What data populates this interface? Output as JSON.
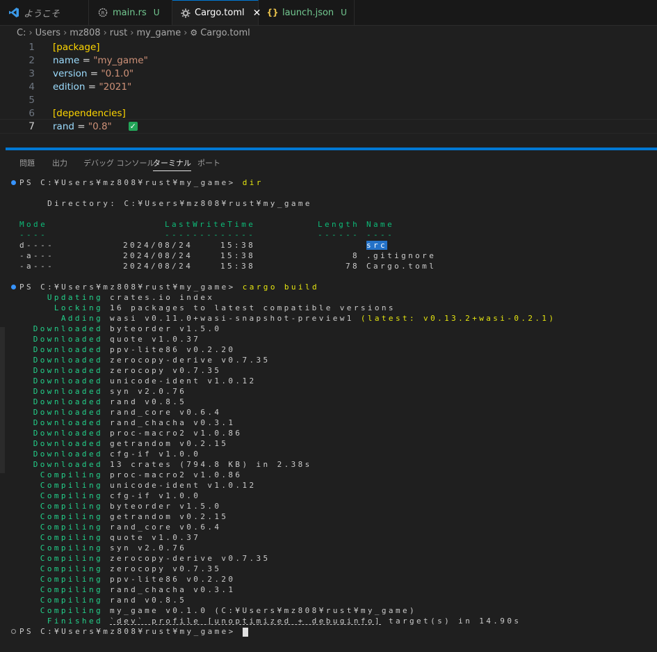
{
  "tabs": [
    {
      "label": "ようこそ",
      "icon": "vscode-icon",
      "modified": "",
      "active": false
    },
    {
      "label": "main.rs",
      "icon": "rust-icon",
      "modified": "U",
      "active": false
    },
    {
      "label": "Cargo.toml",
      "icon": "gear-icon",
      "modified": "",
      "active": true
    },
    {
      "label": "launch.json",
      "icon": "json-braces-icon",
      "modified": "U",
      "active": false
    }
  ],
  "breadcrumb": [
    "C:",
    "Users",
    "mz808",
    "rust",
    "my_game",
    "Cargo.toml"
  ],
  "editor": {
    "lines": [
      {
        "n": "1",
        "text": "[package]"
      },
      {
        "n": "2",
        "key": "name",
        "value": "\"my_game\""
      },
      {
        "n": "3",
        "key": "version",
        "value": "\"0.1.0\""
      },
      {
        "n": "4",
        "key": "edition",
        "value": "\"2021\""
      },
      {
        "n": "5",
        "text": ""
      },
      {
        "n": "6",
        "text": "[dependencies]"
      },
      {
        "n": "7",
        "key": "rand",
        "value": "\"0.8\""
      }
    ],
    "eq": " = ",
    "check_glyph": "✓"
  },
  "panel_tabs": [
    "問題",
    "出力",
    "デバッグ コンソール",
    "ターミナル",
    "ポート"
  ],
  "terminal": {
    "prompt": "PS C:¥Users¥mz808¥rust¥my_game>",
    "cmd1": "dir",
    "directory_line": "    Directory: C:¥Users¥mz808¥rust¥my_game",
    "headers": {
      "mode": "Mode",
      "time": "LastWriteTime",
      "length": "Length",
      "name": "Name"
    },
    "underlines": {
      "mode": "----",
      "time": "-------------",
      "length": "------",
      "name": "----"
    },
    "rows": [
      {
        "mode": "d----",
        "date": "2024/08/24",
        "time": "15:38",
        "length": "",
        "name": "src"
      },
      {
        "mode": "-a---",
        "date": "2024/08/24",
        "time": "15:38",
        "length": "8",
        "name": ".gitignore"
      },
      {
        "mode": "-a---",
        "date": "2024/08/24",
        "time": "15:38",
        "length": "78",
        "name": "Cargo.toml"
      }
    ],
    "cmd2": "cargo build",
    "cargo": [
      {
        "tag": "Updating",
        "text": "crates.io index"
      },
      {
        "tag": "Locking",
        "text": "16 packages to latest compatible versions"
      },
      {
        "tag": "Adding",
        "text": "wasi v0.11.0+wasi-snapshot-preview1 ",
        "extra": "(latest: v0.13.2+wasi-0.2.1)"
      },
      {
        "tag": "Downloaded",
        "text": "byteorder v1.5.0"
      },
      {
        "tag": "Downloaded",
        "text": "quote v1.0.37"
      },
      {
        "tag": "Downloaded",
        "text": "ppv-lite86 v0.2.20"
      },
      {
        "tag": "Downloaded",
        "text": "zerocopy-derive v0.7.35"
      },
      {
        "tag": "Downloaded",
        "text": "zerocopy v0.7.35"
      },
      {
        "tag": "Downloaded",
        "text": "unicode-ident v1.0.12"
      },
      {
        "tag": "Downloaded",
        "text": "syn v2.0.76"
      },
      {
        "tag": "Downloaded",
        "text": "rand v0.8.5"
      },
      {
        "tag": "Downloaded",
        "text": "rand_core v0.6.4"
      },
      {
        "tag": "Downloaded",
        "text": "rand_chacha v0.3.1"
      },
      {
        "tag": "Downloaded",
        "text": "proc-macro2 v1.0.86"
      },
      {
        "tag": "Downloaded",
        "text": "getrandom v0.2.15"
      },
      {
        "tag": "Downloaded",
        "text": "cfg-if v1.0.0"
      },
      {
        "tag": "Downloaded",
        "text": "13 crates (794.8 KB) in 2.38s"
      },
      {
        "tag": "Compiling",
        "text": "proc-macro2 v1.0.86"
      },
      {
        "tag": "Compiling",
        "text": "unicode-ident v1.0.12"
      },
      {
        "tag": "Compiling",
        "text": "cfg-if v1.0.0"
      },
      {
        "tag": "Compiling",
        "text": "byteorder v1.5.0"
      },
      {
        "tag": "Compiling",
        "text": "getrandom v0.2.15"
      },
      {
        "tag": "Compiling",
        "text": "rand_core v0.6.4"
      },
      {
        "tag": "Compiling",
        "text": "quote v1.0.37"
      },
      {
        "tag": "Compiling",
        "text": "syn v2.0.76"
      },
      {
        "tag": "Compiling",
        "text": "zerocopy-derive v0.7.35"
      },
      {
        "tag": "Compiling",
        "text": "zerocopy v0.7.35"
      },
      {
        "tag": "Compiling",
        "text": "ppv-lite86 v0.2.20"
      },
      {
        "tag": "Compiling",
        "text": "rand_chacha v0.3.1"
      },
      {
        "tag": "Compiling",
        "text": "rand v0.8.5"
      },
      {
        "tag": "Compiling",
        "text": "my_game v0.1.0 (C:¥Users¥mz808¥rust¥my_game)"
      },
      {
        "tag": "Finished",
        "text": "`dev` profile [unoptimized + debuginfo]",
        "tail": " target(s) in 14.90s"
      }
    ]
  },
  "colors": {
    "accent": "#0078d4",
    "terminal_green": "#0dbc79",
    "terminal_yellow": "#e5e510"
  }
}
